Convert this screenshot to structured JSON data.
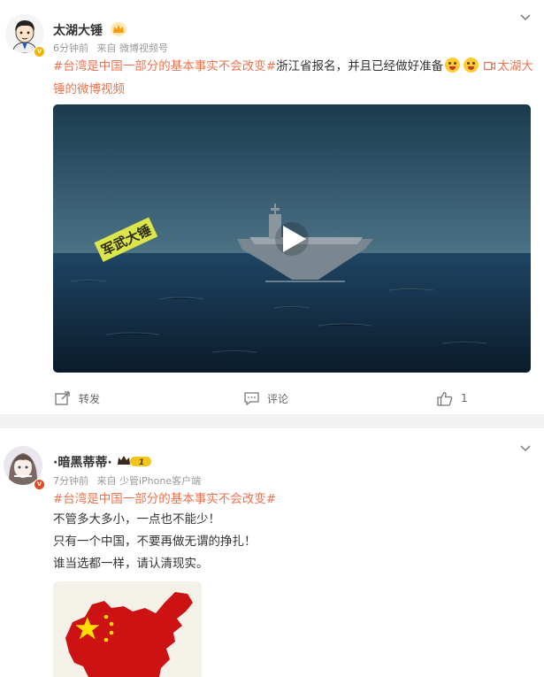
{
  "post1": {
    "user": {
      "name": "太湖大锤"
    },
    "meta": {
      "time": "6分钟前",
      "source": "来自 微博视频号"
    },
    "text": {
      "hashtag": "#台湾是中国一部分的基本事实不会改变#",
      "body": "浙江省报名，并且已经做好准备",
      "link": "太湖大锤的微博视频"
    },
    "video": {
      "watermark": "军武大锤"
    },
    "actions": {
      "repost": "转发",
      "comment": "评论",
      "like_count": "1"
    }
  },
  "post2": {
    "user": {
      "name": "·暗黑蒂蒂·",
      "level": "1"
    },
    "meta": {
      "time": "7分钟前",
      "source": "来自 少管iPhone客户端"
    },
    "text": {
      "hashtag": "#台湾是中国一部分的基本事实不会改变#",
      "lines": [
        "不管多大多小，一点也不能少！",
        "只有一个中国，不要再做无谓的挣扎！",
        "谁当选都一样，请认清现实。"
      ]
    }
  },
  "colors": {
    "link": "#eb7350",
    "meta": "#999999",
    "divider": "#f2f2f2"
  }
}
